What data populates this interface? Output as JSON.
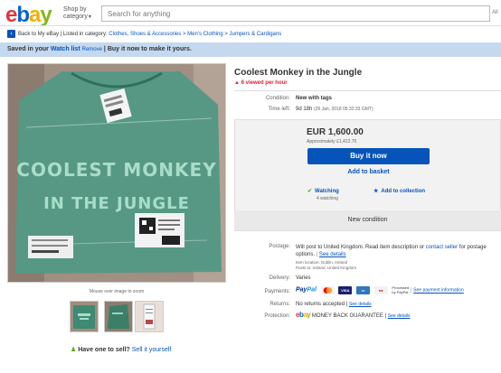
{
  "header": {
    "logo": {
      "e": "e",
      "b": "b",
      "a": "a",
      "y": "y"
    },
    "shop_by_line1": "Shop by",
    "shop_by_line2": "category",
    "search_placeholder": "Search for anything",
    "search_right": "All"
  },
  "breadcrumb": {
    "back": "Back to My eBay",
    "listed_in": "| Listed in category:",
    "path": "Clothes, Shoes & Accessories > Men's Clothing > Jumpers & Cardigans"
  },
  "banner": {
    "saved": "Saved in your",
    "watch_list": "Watch list",
    "remove": "Remove",
    "cta": "| Buy it now to make it yours."
  },
  "gallery": {
    "hover_hint": "Mouse over image to zoom",
    "sweater_line1": "COOLEST MONKEY",
    "sweater_line2": "IN THE JUNGLE",
    "have_one": "Have one to sell?",
    "sell_it": "Sell it yourself"
  },
  "listing": {
    "title": "Coolest Monkey in the Jungle",
    "viewed": "6 viewed per hour",
    "condition_label": "Condition:",
    "condition_value": "New with tags",
    "time_left_label": "Time left:",
    "time_left_value": "9d 18h",
    "time_left_date": "(26 Jan, 2018  05:32:33 GMT)"
  },
  "buybox": {
    "price": "EUR 1,600.00",
    "approx": "Approximately £1,422.70",
    "buy_now": "Buy it now",
    "add_basket": "Add to basket",
    "watching": "Watching",
    "watch_count": "4 watching",
    "add_collection": "Add to collection",
    "new_condition": "New condition"
  },
  "details": {
    "postage_label": "Postage:",
    "postage_text": "Will post to United Kingdom. Read item description or",
    "contact_seller": "contact seller",
    "postage_text2": "for postage options.",
    "see_details": "See details",
    "item_location": "Item location:  Dublin, Ireland",
    "posts_to": "Posts to:  Ireland, United Kingdom",
    "delivery_label": "Delivery:",
    "delivery_value": "Varies",
    "payments_label": "Payments:",
    "paypal_a": "Pay",
    "paypal_b": "Pal",
    "visa": "VISA",
    "processed": "Processed",
    "by_paypal": "by PayPal",
    "see_payment": "See payment information",
    "returns_label": "Returns:",
    "returns_value": "No returns accepted |",
    "protection_label": "Protection:",
    "money_back": "MONEY BACK GUARANTEE |"
  },
  "colors": {
    "ebay_red": "#e53238",
    "ebay_blue": "#0064d2",
    "ebay_yellow": "#f5af02",
    "ebay_green": "#86b817",
    "buy_button": "#0654ba",
    "banner_bg": "#c4d9ef",
    "sweater_green": "#3f8a73"
  }
}
